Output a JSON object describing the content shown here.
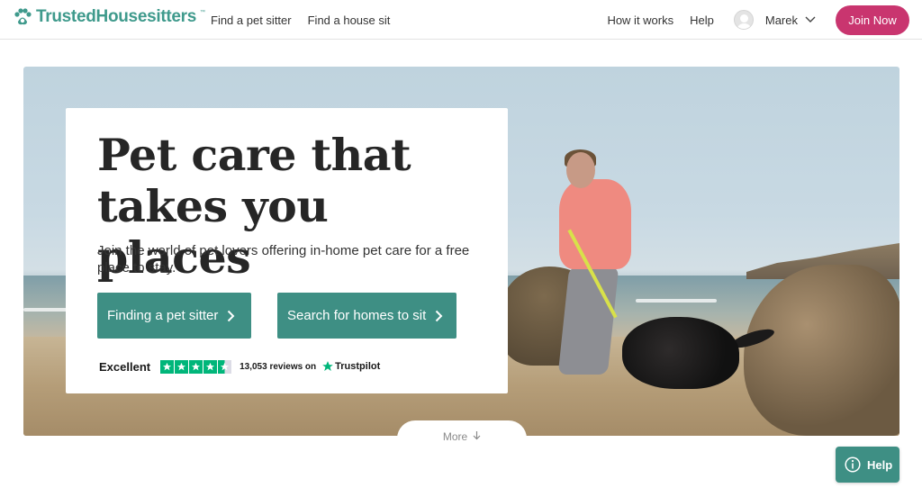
{
  "header": {
    "logo_text": "TrustedHousesitters",
    "logo_tm": "™",
    "nav_left": [
      "Find a pet sitter",
      "Find a house sit"
    ],
    "nav_right": [
      "How it works",
      "Help"
    ],
    "user_name": "Marek",
    "join_label": "Join Now"
  },
  "hero": {
    "title_line1": "Pet care that",
    "title_line2": "takes you places",
    "subtitle": "Join the world of pet lovers offering in-home pet care for a free place to stay.",
    "cta_sitter": "Finding a pet sitter",
    "cta_homes": "Search for homes to sit",
    "trust_rating": "Excellent",
    "trust_stars": 4.5,
    "trust_count": "13,053 reviews on",
    "trust_brand": "Trustpilot"
  },
  "more_label": "More",
  "help_label": "Help",
  "colors": {
    "brand_teal": "#3e8f84",
    "logo_teal": "#3f9a8c",
    "join_pink": "#c9356f",
    "trustpilot_green": "#00b67a"
  }
}
